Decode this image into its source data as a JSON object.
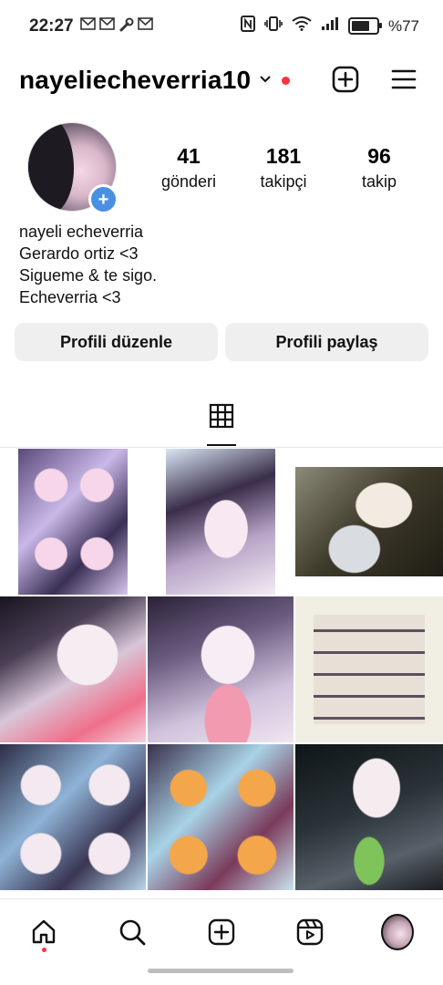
{
  "status_bar": {
    "time": "22:27",
    "notification_icons": [
      "mail-icon",
      "mail-icon",
      "wrench-icon",
      "mail-icon"
    ],
    "battery_text": "%77"
  },
  "header": {
    "username": "nayeliecheverria10"
  },
  "profile": {
    "stats": [
      {
        "value": "41",
        "label": "gönderi"
      },
      {
        "value": "181",
        "label": "takipçi"
      },
      {
        "value": "96",
        "label": "takip"
      }
    ],
    "display_name": "nayeli echeverria",
    "bio_lines": [
      "Gerardo ortiz <3",
      "Sigueme & te sigo.",
      "Echeverria <3"
    ],
    "add_badge": "+"
  },
  "actions": {
    "edit_profile": "Profili düzenle",
    "share_profile": "Profili paylaş"
  },
  "colors": {
    "accent_blue": "#4a90e2",
    "notification_red": "#ff3040",
    "button_gray": "#efefef"
  },
  "grid_posts": [
    {
      "kind": "collage-4"
    },
    {
      "kind": "selfie-lying"
    },
    {
      "kind": "selfie-dark"
    },
    {
      "kind": "selfie-smile"
    },
    {
      "kind": "selfie-smile"
    },
    {
      "kind": "eyebrow-chart"
    },
    {
      "kind": "collage-4"
    },
    {
      "kind": "collage-4"
    },
    {
      "kind": "selfie-dark"
    }
  ],
  "bottom_nav": [
    "home-icon",
    "search-icon",
    "create-icon",
    "reels-icon",
    "profile-avatar"
  ]
}
